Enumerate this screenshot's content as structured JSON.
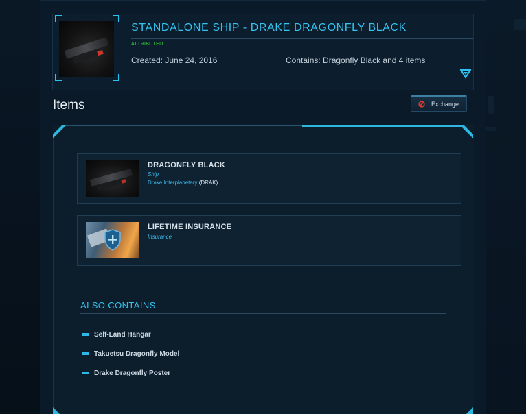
{
  "pledge": {
    "title": "STANDALONE SHIP - DRAKE DRAGONFLY BLACK",
    "status": "ATTRIBUTED",
    "created": "Created: June 24, 2016",
    "contains": "Contains: Dragonfly Black and 4 items"
  },
  "items_section": {
    "heading": "Items",
    "exchange_label": "Exchange"
  },
  "items": [
    {
      "name": "DRAGONFLY BLACK",
      "type": "Ship",
      "manufacturer": "Drake Interplanetary",
      "manufacturer_code": "(DRAK)"
    },
    {
      "name": "LIFETIME INSURANCE",
      "type": "Insurance"
    }
  ],
  "also_contains": {
    "heading": "ALSO CONTAINS",
    "items": [
      "Self-Land Hangar",
      "Takuetsu Dragonfly Model",
      "Drake Dragonfly Poster"
    ]
  },
  "colors": {
    "accent": "#34c3ee",
    "status_green": "#34d13a",
    "background": "#0b1a28"
  },
  "icons": [
    "expand-arrow-icon",
    "prohibited-icon",
    "shield-plus-icon"
  ]
}
